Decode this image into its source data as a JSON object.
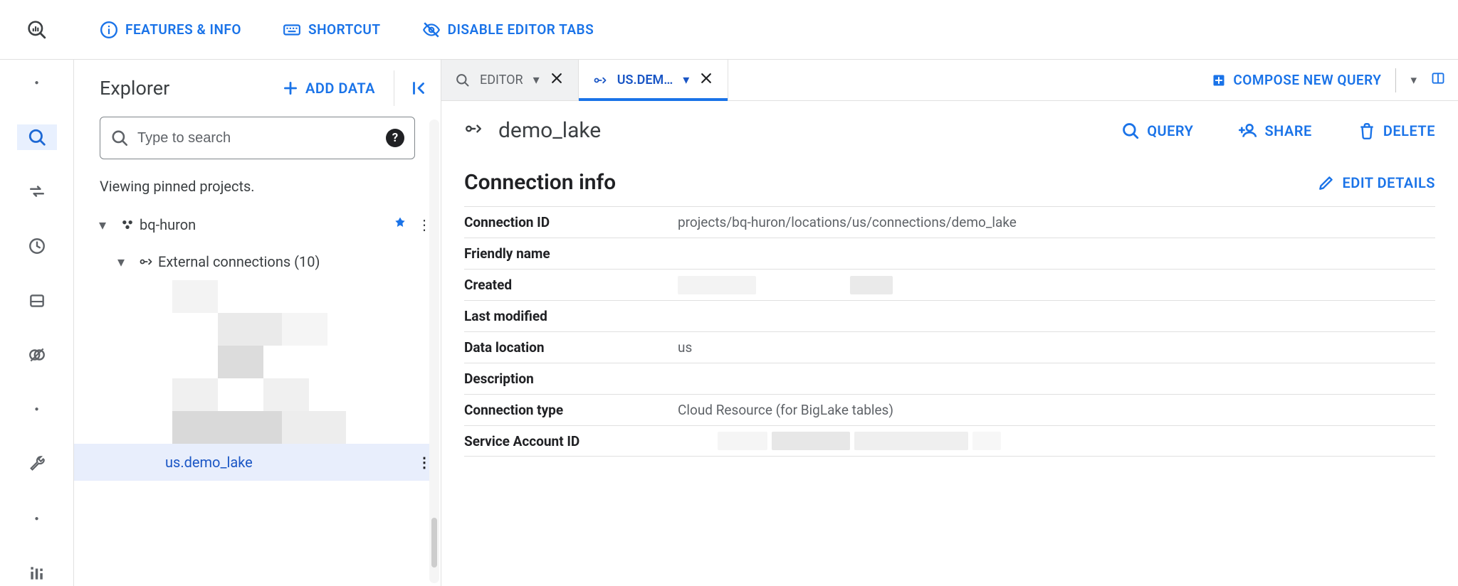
{
  "toolbar": {
    "features_label": "FEATURES & INFO",
    "shortcut_label": "SHORTCUT",
    "disable_tabs_label": "DISABLE EDITOR TABS"
  },
  "explorer": {
    "title": "Explorer",
    "add_data_label": "ADD DATA",
    "search_placeholder": "Type to search",
    "status": "Viewing pinned projects.",
    "project": {
      "name": "bq-huron"
    },
    "external_connections_label": "External connections (10)",
    "selected_connection": "us.demo_lake"
  },
  "tabs": {
    "editor_label": "EDITOR",
    "active_label": "US.DEM…",
    "compose_label": "COMPOSE NEW QUERY"
  },
  "resource": {
    "name": "demo_lake",
    "actions": {
      "query": "QUERY",
      "share": "SHARE",
      "delete": "DELETE"
    }
  },
  "section": {
    "title": "Connection info",
    "edit_label": "EDIT DETAILS"
  },
  "info": {
    "rows": [
      {
        "key": "Connection ID",
        "value": "projects/bq-huron/locations/us/connections/demo_lake"
      },
      {
        "key": "Friendly name",
        "value": ""
      },
      {
        "key": "Created",
        "value": ""
      },
      {
        "key": "Last modified",
        "value": ""
      },
      {
        "key": "Data location",
        "value": "us"
      },
      {
        "key": "Description",
        "value": ""
      },
      {
        "key": "Connection type",
        "value": "Cloud Resource (for BigLake tables)"
      },
      {
        "key": "Service Account ID",
        "value": ""
      }
    ]
  }
}
